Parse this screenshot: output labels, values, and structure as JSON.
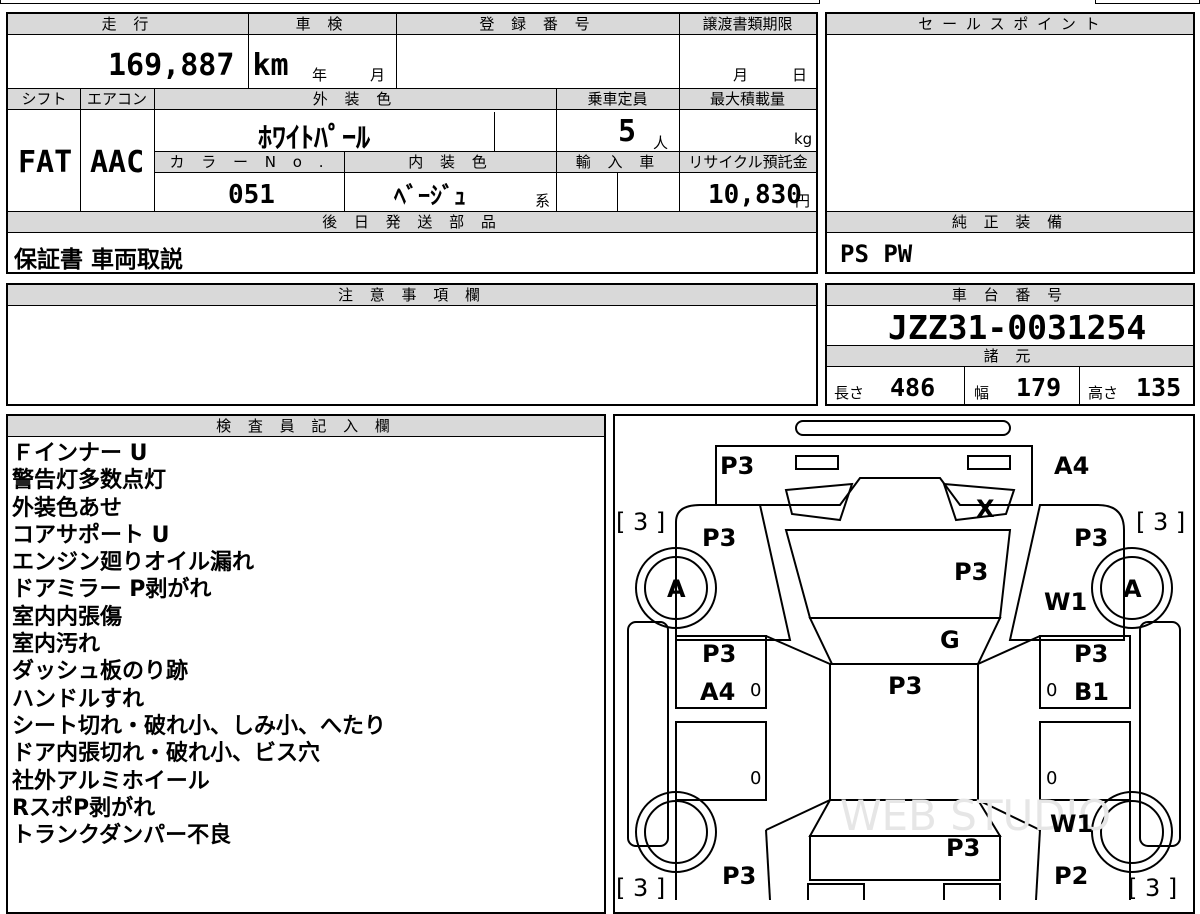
{
  "labels": {
    "mileage": "走 行",
    "inspection": "車 検",
    "registration": "登 録 番 号",
    "deadline": "譲渡書類期限",
    "sales": "セ ー ル ス ポ イ ン ト",
    "shift": "シフト",
    "ac": "エアコン",
    "exterior": "外 装 色",
    "capacity": "乗車定員",
    "max_load": "最大積載量",
    "color_no": "カ ラ ー N o .",
    "interior": "内 装 色",
    "import": "輸 入 車",
    "recycle": "リサイクル預託金",
    "later": "後 日 発 送 部 品",
    "genuine": "純 正 装 備",
    "caution": "注 意 事 項 欄",
    "chassis": "車 台 番 号",
    "specs": "諸 元",
    "inspector": "検 査 員 記 入 欄",
    "year": "年",
    "month": "月",
    "month2": "月",
    "day": "日",
    "person": "人",
    "kg": "kg",
    "yen": "円",
    "kei": "系",
    "length": "長さ",
    "width": "幅",
    "height": "高さ"
  },
  "values": {
    "mileage": "169,887 km",
    "shift": "FAT",
    "ac": "AAC",
    "exterior_color": "ﾎﾜｲﾄﾊﾟｰﾙ",
    "capacity": "5",
    "color_no": "051",
    "interior_color": "ﾍﾞｰｼﾞｭ",
    "recycle": "10,830",
    "later_parts": "保証書 車両取説",
    "genuine": "PS PW",
    "chassis_no": "JZZ31-0031254",
    "length": "486",
    "width": "179",
    "height": "135"
  },
  "inspector_notes": [
    "Ｆインナー U",
    "警告灯多数点灯",
    "外装色あせ",
    "コアサポート U",
    "エンジン廻りオイル漏れ",
    "ドアミラー P剥がれ",
    "室内内張傷",
    "室内汚れ",
    "ダッシュ板のり跡",
    "ハンドルすれ",
    "シート切れ・破れ小、しみ小、へたり",
    "ドア内張切れ・破れ小、ビス穴",
    "社外アルミホイール",
    "RスポP剥がれ",
    "トランクダンパー不良"
  ],
  "diagram": {
    "marks": {
      "front_left": "P3",
      "front_right": "A4",
      "bracket_tl": "[ 3 ]",
      "bracket_tr": "[ 3 ]",
      "fender_l": "P3",
      "fender_r": "P3",
      "headlight_x": "X",
      "hood": "P3",
      "fender_r_w": "W1",
      "tire_fl": "A",
      "tire_fr": "A",
      "windshield": "G",
      "door_fl": "P3",
      "door_fl2": "A4",
      "roof": "P3",
      "door_fr": "P3",
      "door_fr2": "B1",
      "zero1": "0",
      "zero2": "0",
      "zero3": "0",
      "zero4": "0",
      "rear_w": "W1",
      "trunk": "P3",
      "rear_l": "P3",
      "rear_r": "P2",
      "bracket_bl": "[ 3 ]",
      "bracket_br": "[ 3 ]"
    },
    "watermark": "WEB STUDIO"
  }
}
